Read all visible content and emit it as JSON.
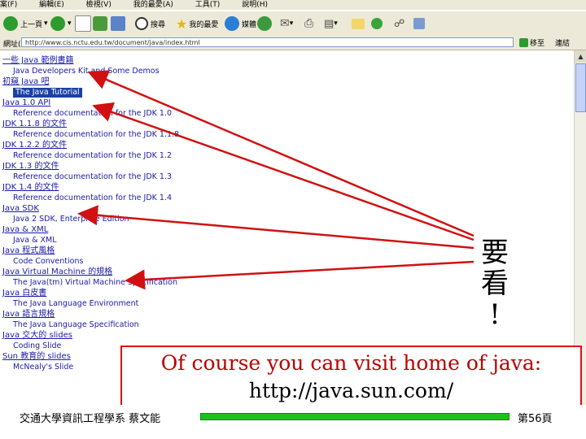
{
  "menu": [
    "案(F)",
    "編輯(E)",
    "檢視(V)",
    "我的最愛(A)",
    "工具(T)",
    "說明(H)"
  ],
  "toolbar": {
    "back": "上一頁",
    "search": "搜尋",
    "favorites": "我的最愛",
    "media": "媒體"
  },
  "address": {
    "label": "網址(D)",
    "url": "http://www.cis.nctu.edu.tw/document/java/index.html",
    "go": "移至",
    "links": "連結"
  },
  "content": {
    "items": [
      {
        "type": "header",
        "text": "一些 Java 範例書籍"
      },
      {
        "type": "sub",
        "text": "Java Developers Kit and Some Demos"
      },
      {
        "type": "header",
        "text": "初窺 Java 吧"
      },
      {
        "type": "sub",
        "text": "The Java Tutorial",
        "selected": true
      },
      {
        "type": "header",
        "text": "Java 1.0 API"
      },
      {
        "type": "sub",
        "text": "Reference documentation for the JDK 1.0"
      },
      {
        "type": "header",
        "text": "JDK 1.1.8 的文件"
      },
      {
        "type": "sub",
        "text": "Reference documentation for the JDK 1.1.8"
      },
      {
        "type": "header",
        "text": "JDK 1.2.2 的文件"
      },
      {
        "type": "sub",
        "text": "Reference documentation for the JDK 1.2"
      },
      {
        "type": "header",
        "text": "JDK 1.3 的文件"
      },
      {
        "type": "sub",
        "text": "Reference documentation for the JDK 1.3"
      },
      {
        "type": "header",
        "text": "JDK 1.4 的文件"
      },
      {
        "type": "sub",
        "text": "Reference documentation for the JDK 1.4"
      },
      {
        "type": "header",
        "text": "Java SDK"
      },
      {
        "type": "sub",
        "text": "Java 2 SDK, Enterprise Edition"
      },
      {
        "type": "header",
        "text": "Java & XML"
      },
      {
        "type": "sub",
        "text": "Java & XML"
      },
      {
        "type": "header",
        "text": "Java 程式風格"
      },
      {
        "type": "sub",
        "text": "Code Conventions"
      },
      {
        "type": "header",
        "text": "Java Virtual Machine 的規格"
      },
      {
        "type": "sub",
        "text": "The Java(tm) Virtual Machine Specification"
      },
      {
        "type": "header",
        "text": "Java 白皮書"
      },
      {
        "type": "sub",
        "text": "The Java Language Environment"
      },
      {
        "type": "header",
        "text": "Java 語言規格"
      },
      {
        "type": "sub",
        "text": "The Java Language Specification"
      },
      {
        "type": "header",
        "text": "Java 交大的 slides"
      },
      {
        "type": "sub",
        "text": "Coding Slide"
      },
      {
        "type": "header",
        "text": "Sun 教育的 slides"
      },
      {
        "type": "sub",
        "text": "McNealy's Slide"
      }
    ]
  },
  "note": {
    "vertical_chars": [
      "要",
      "看",
      "!"
    ]
  },
  "callout": {
    "line1": "Of course you can visit home of java:",
    "line2": "http://java.sun.com/"
  },
  "footer": {
    "department": "交通大學資訊工程學系 蔡文能",
    "page": "第56頁"
  },
  "colors": {
    "link": "#1a1aa8",
    "selected_bg": "#1b3fa6",
    "arrow": "#d11111",
    "callout_text": "#b00000",
    "footer_bar": "#1cc21c"
  }
}
